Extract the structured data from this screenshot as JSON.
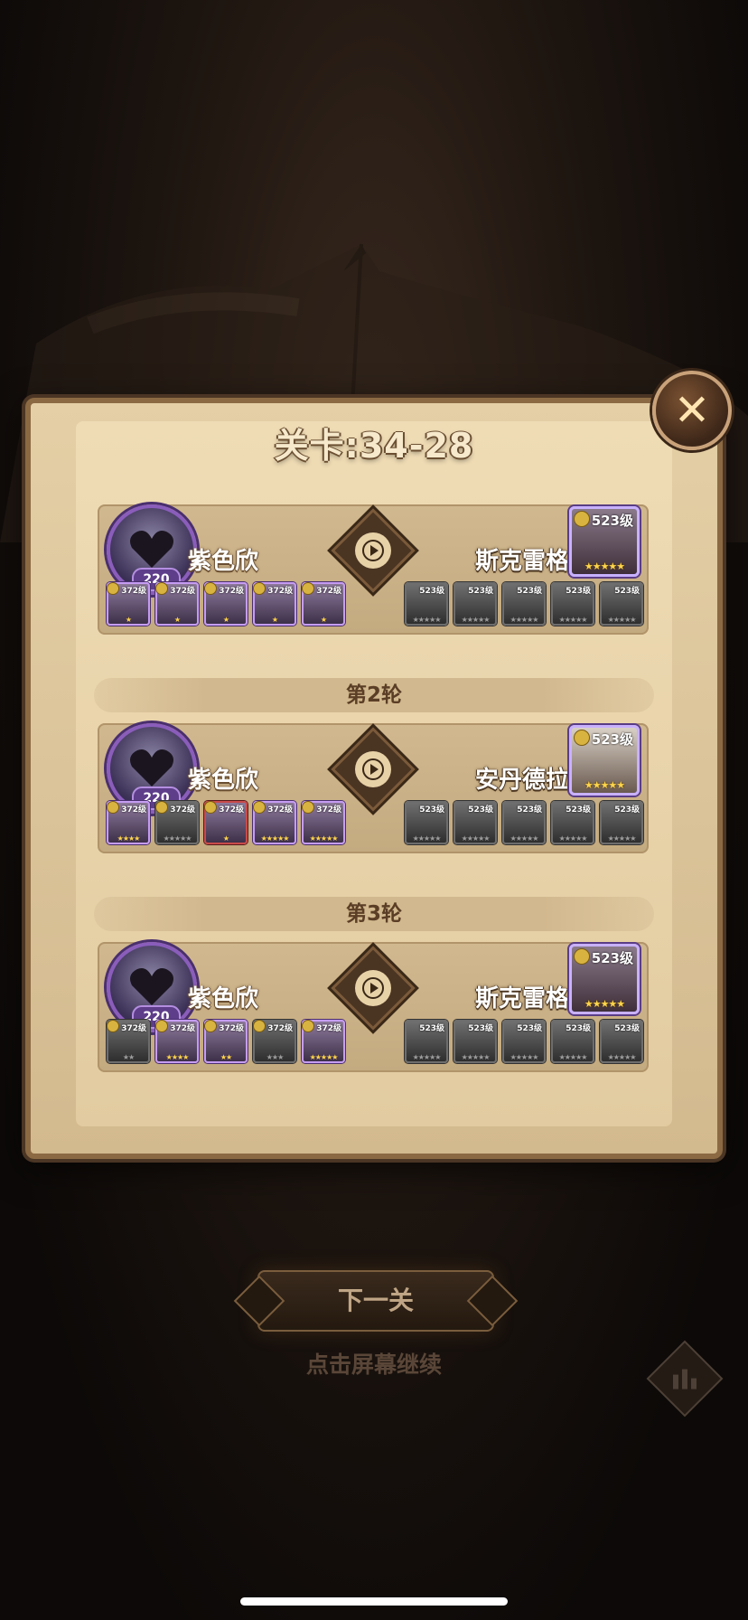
{
  "stage": {
    "title": "关卡:34-28"
  },
  "rounds": [
    {
      "label": "",
      "player": {
        "name": "紫色欣",
        "level": "220"
      },
      "enemy": {
        "name": "斯克雷格",
        "level": "523级"
      },
      "player_heroes": [
        {
          "level": "372级",
          "stars": "★",
          "dim": false
        },
        {
          "level": "372级",
          "stars": "★",
          "dim": false
        },
        {
          "level": "372级",
          "stars": "★",
          "dim": false
        },
        {
          "level": "372级",
          "stars": "★",
          "dim": false
        },
        {
          "level": "372级",
          "stars": "★",
          "dim": false
        }
      ],
      "enemy_heroes": [
        "523级",
        "523级",
        "523级",
        "523级",
        "523级"
      ]
    },
    {
      "label": "第2轮",
      "player": {
        "name": "紫色欣",
        "level": "220"
      },
      "enemy": {
        "name": "安丹德拉",
        "level": "523级"
      },
      "player_heroes": [
        {
          "level": "372级",
          "stars": "★★★★",
          "dim": false
        },
        {
          "level": "372级",
          "stars": "★★★★★",
          "dim": true
        },
        {
          "level": "372级",
          "stars": "★",
          "dim": false
        },
        {
          "level": "372级",
          "stars": "★★★★★",
          "dim": false
        },
        {
          "level": "372级",
          "stars": "★★★★★",
          "dim": false
        }
      ],
      "enemy_heroes": [
        "523级",
        "523级",
        "523级",
        "523级",
        "523级"
      ]
    },
    {
      "label": "第3轮",
      "player": {
        "name": "紫色欣",
        "level": "220"
      },
      "enemy": {
        "name": "斯克雷格",
        "level": "523级"
      },
      "player_heroes": [
        {
          "level": "372级",
          "stars": "★★",
          "dim": true
        },
        {
          "level": "372级",
          "stars": "★★★★",
          "dim": false
        },
        {
          "level": "372级",
          "stars": "★★",
          "dim": false
        },
        {
          "level": "372级",
          "stars": "★★★",
          "dim": true
        },
        {
          "level": "372级",
          "stars": "★★★★★",
          "dim": false
        }
      ],
      "enemy_heroes": [
        "523级",
        "523级",
        "523级",
        "523级",
        "523级"
      ]
    }
  ],
  "enemy_stars": "★★★★★",
  "buttons": {
    "next": "下一关"
  },
  "hint": "点击屏幕继续",
  "colors": {
    "accent": "#8a5dbb",
    "gold": "#ffd54a",
    "parchment": "#e2cba0"
  }
}
